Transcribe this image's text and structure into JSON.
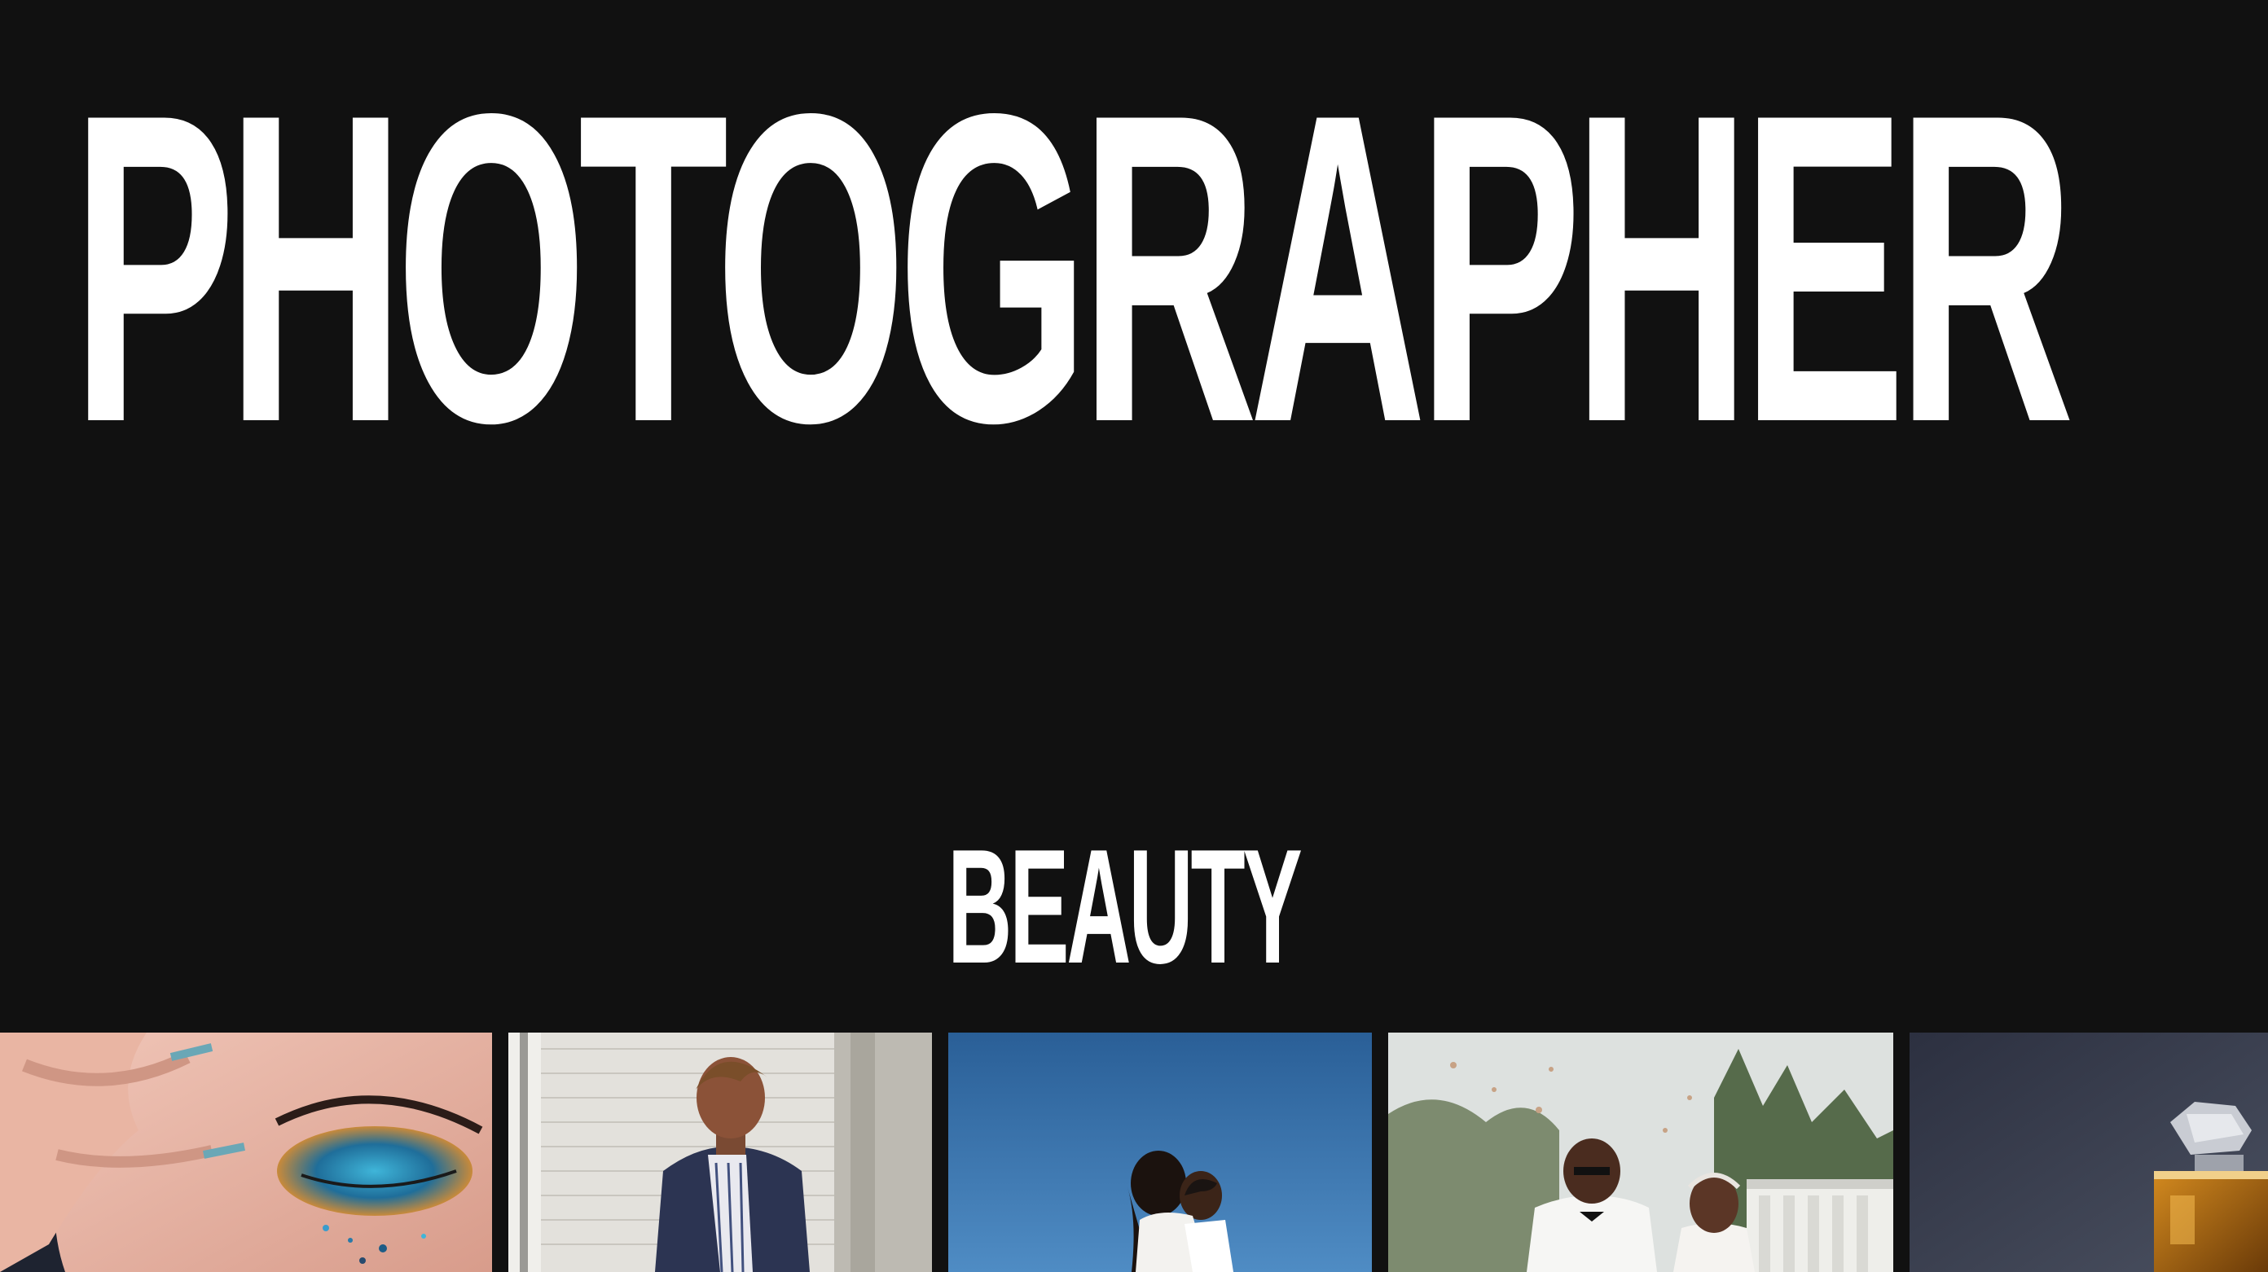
{
  "hero": {
    "title": "PHOTOGRAPHER"
  },
  "section": {
    "title": "BEAUTY"
  },
  "gallery": {
    "items": [
      {
        "subject": "glitter-eye-makeup-photo"
      },
      {
        "subject": "fashion-portrait-photo"
      },
      {
        "subject": "couple-kiss-sky-photo"
      },
      {
        "subject": "wedding-couple-photo"
      },
      {
        "subject": "perfume-bottle-photo"
      }
    ]
  },
  "colors": {
    "background": "#111111",
    "text": "#ffffff"
  }
}
